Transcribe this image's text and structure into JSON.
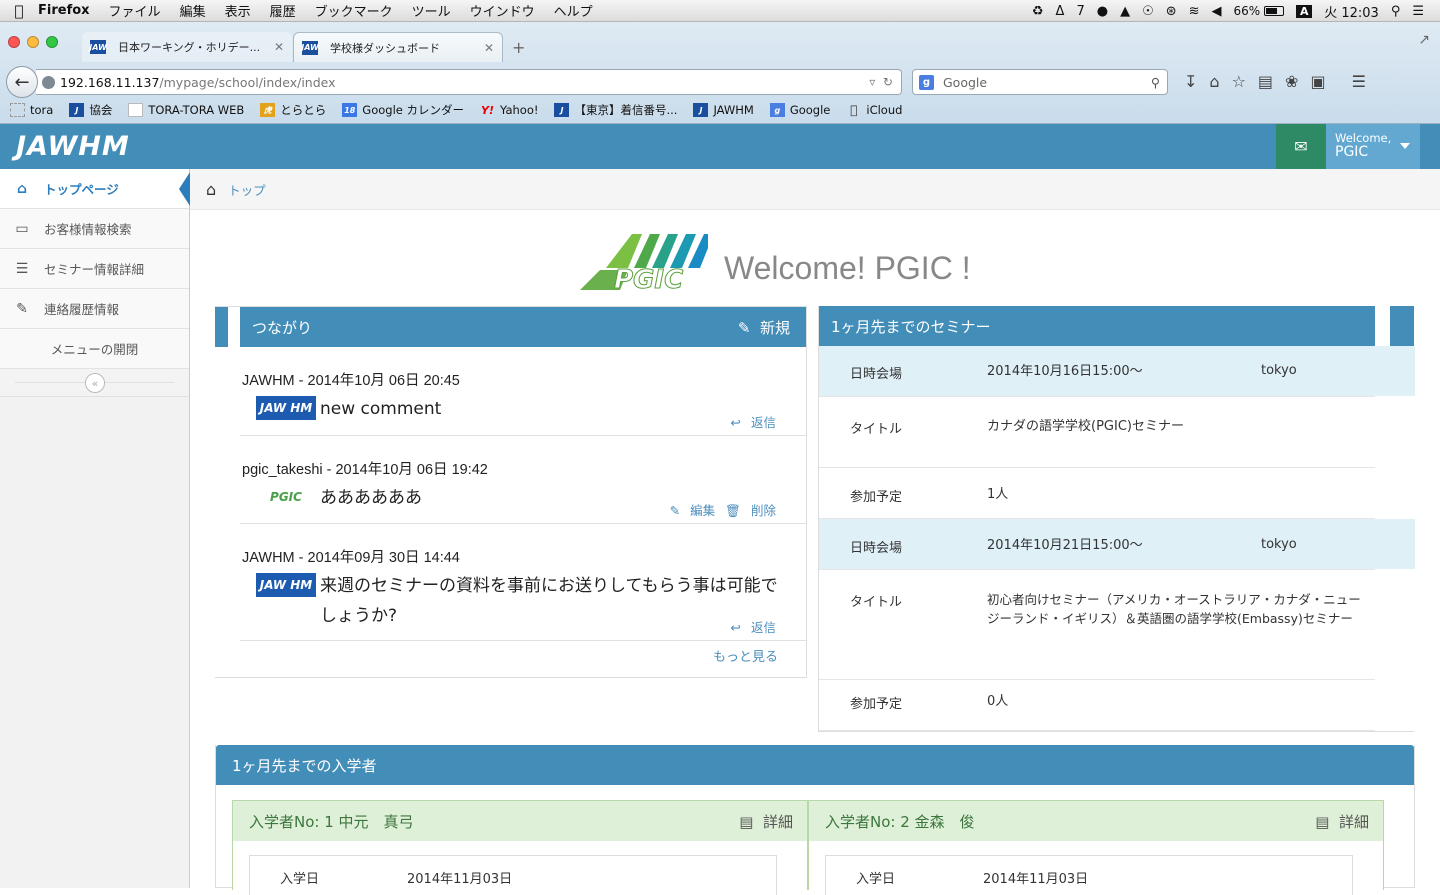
{
  "menubar": {
    "app": "Firefox",
    "items": [
      "ファイル",
      "編集",
      "表示",
      "履歴",
      "ブックマーク",
      "ツール",
      "ウインドウ",
      "ヘルプ"
    ],
    "status": {
      "adobe_count": "7",
      "battery": "66%",
      "ime": "A",
      "clock": "火 12:03"
    }
  },
  "tabs": [
    {
      "title": "日本ワーキング・ホリデー...",
      "fav": "JAW"
    },
    {
      "title": "学校様ダッシュボード",
      "fav": "JAW"
    }
  ],
  "url": {
    "host": "192.168.11.137",
    "path": "/mypage/school/index/index"
  },
  "search": {
    "placeholder": "Google"
  },
  "bookmarks": [
    {
      "label": "tora"
    },
    {
      "label": "協会"
    },
    {
      "label": "TORA-TORA WEB"
    },
    {
      "label": "とらとら"
    },
    {
      "label": "Google カレンダー"
    },
    {
      "label": "Yahoo!"
    },
    {
      "label": "【東京】着信番号..."
    },
    {
      "label": "JAWHM"
    },
    {
      "label": "Google"
    },
    {
      "label": "iCloud"
    }
  ],
  "header": {
    "brand": "JAWHM",
    "welcome": "Welcome,",
    "user": "PGIC"
  },
  "sidebar": {
    "items": [
      {
        "label": "トップページ"
      },
      {
        "label": "お客様情報検索"
      },
      {
        "label": "セミナー情報詳細"
      },
      {
        "label": "連絡履歴情報"
      },
      {
        "label": "メニューの開閉"
      }
    ]
  },
  "breadcrumb": {
    "label": "トップ"
  },
  "welcome": {
    "title": "Welcome! PGIC !",
    "logo_text": "PGIC"
  },
  "connections": {
    "title": "つながり",
    "new_label": "新規",
    "messages": [
      {
        "meta": "JAWHM - 2014年10月 06日 20:45",
        "avatar": "JAW HM",
        "text": "new comment",
        "actions": [
          "返信"
        ]
      },
      {
        "meta": "pgic_takeshi - 2014年10月 06日 19:42",
        "avatar": "PGIC",
        "text": "ああああああ",
        "actions": [
          "編集",
          "削除"
        ]
      },
      {
        "meta": "JAWHM - 2014年09月 30日 14:44",
        "avatar": "JAW HM",
        "text": "来週のセミナーの資料を事前にお送りしてもらう事は可能でしょうか?",
        "actions": [
          "返信"
        ]
      }
    ],
    "more": "もっと見る"
  },
  "seminars": {
    "title": "1ヶ月先までのセミナー",
    "items": [
      {
        "date_key": "日時会場",
        "date": "2014年10月16日15:00〜",
        "place": "tokyo",
        "title_key": "タイトル",
        "title": "カナダの語学学校(PGIC)セミナー",
        "count_key": "参加予定",
        "count": "1人"
      },
      {
        "date_key": "日時会場",
        "date": "2014年10月21日15:00〜",
        "place": "tokyo",
        "title_key": "タイトル",
        "title": "初心者向けセミナー（アメリカ・オーストラリア・カナダ・ニュージーランド・イギリス）＆英語圏の語学学校(Embassy)セミナー",
        "count_key": "参加予定",
        "count": "0人"
      }
    ]
  },
  "entrants": {
    "title": "1ヶ月先までの入学者",
    "items": [
      {
        "heading": "入学者No: 1 中元　真弓",
        "detail": "詳細",
        "date_key": "入学日",
        "date": "2014年11月03日"
      },
      {
        "heading": "入学者No: 2 金森　俊",
        "detail": "詳細",
        "date_key": "入学日",
        "date": "2014年11月03日"
      }
    ]
  },
  "colors": {
    "primary": "#438eb9",
    "mail": "#2e8965",
    "user": "#62a8d1",
    "link": "#4c8fbd",
    "success_bg": "#dff0d8"
  }
}
